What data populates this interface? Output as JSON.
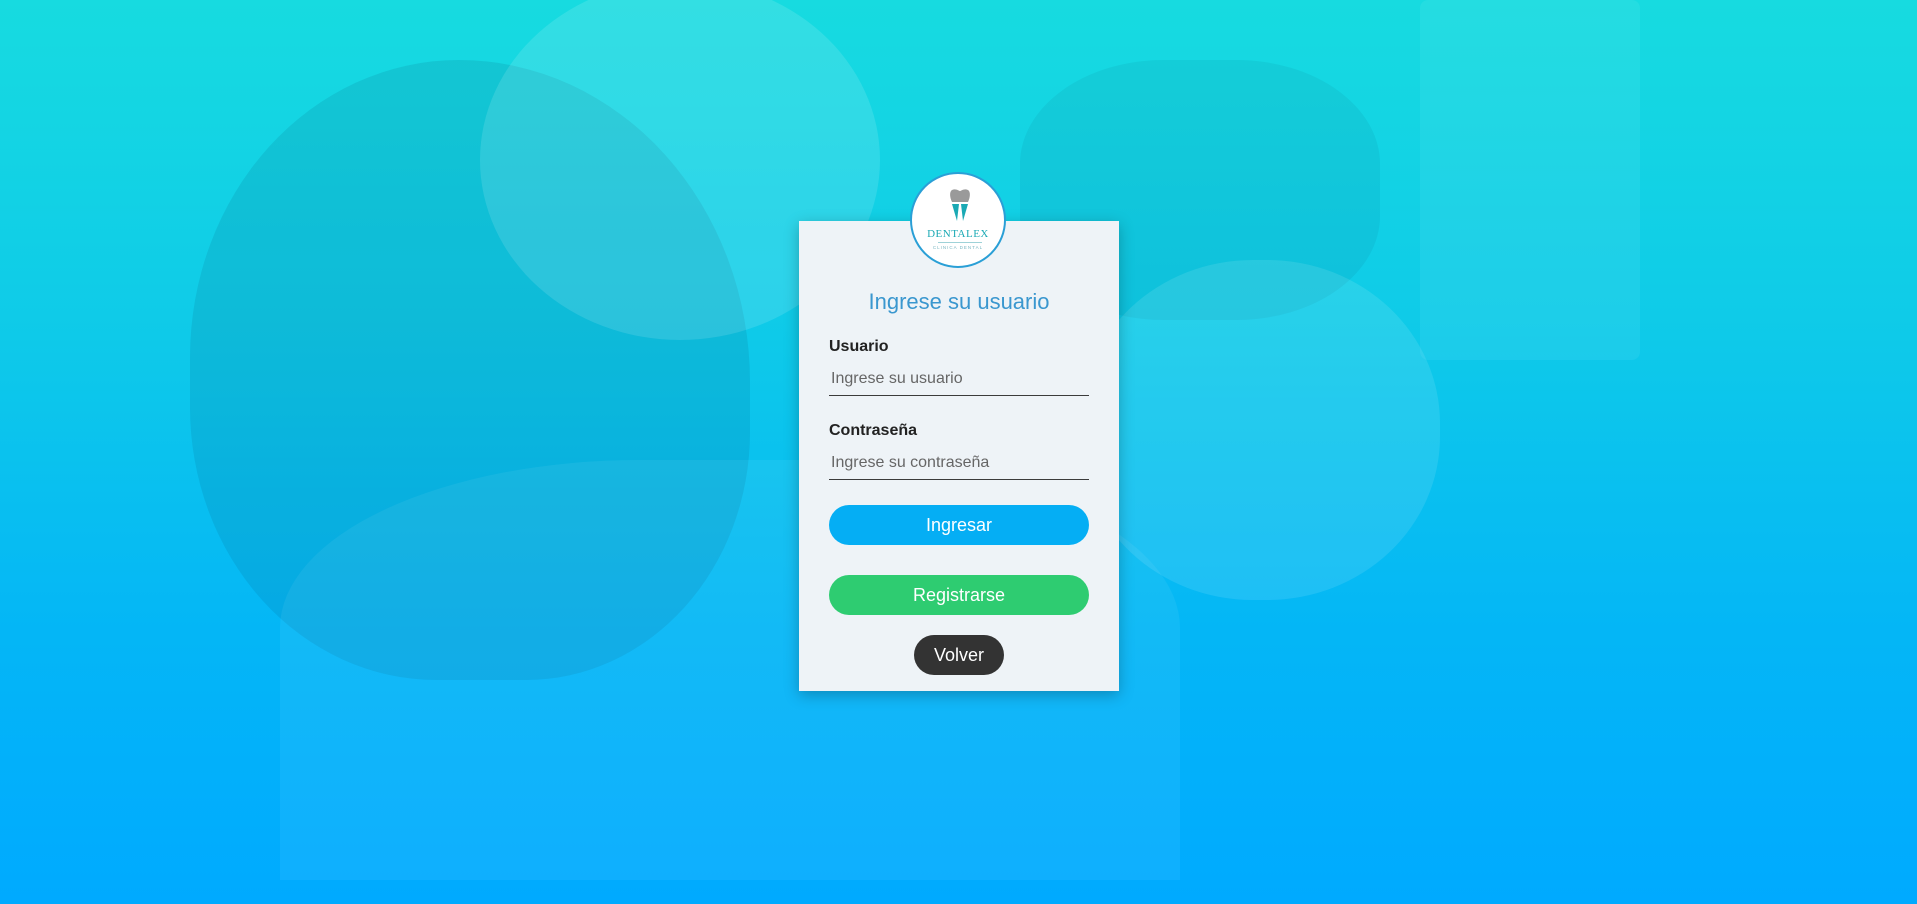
{
  "colors": {
    "background_top": "#17dbe0",
    "background_bottom": "#00aaff",
    "card": "#eef3f7",
    "title": "#3a97cf",
    "primary_button": "#05aef4",
    "register_button": "#2ecc71",
    "back_button": "#333333"
  },
  "logo": {
    "icon": "tooth-icon",
    "name": "DENTALEX",
    "subtitle": "CLINICA DENTAL"
  },
  "form": {
    "title": "Ingrese su usuario",
    "username": {
      "label": "Usuario",
      "placeholder": "Ingrese su usuario",
      "value": ""
    },
    "password": {
      "label": "Contraseña",
      "placeholder": "Ingrese su contraseña",
      "value": ""
    },
    "submit_label": "Ingresar",
    "register_label": "Registrarse",
    "back_label": "Volver"
  }
}
